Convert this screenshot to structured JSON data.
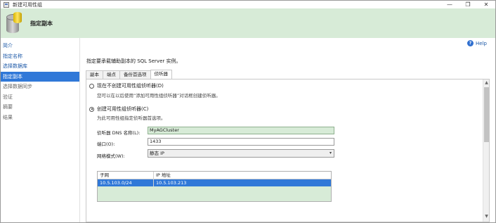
{
  "window": {
    "title": "新建可用性组",
    "controls": {
      "minimize": "—",
      "maximize": "❐",
      "close": "✕"
    }
  },
  "header": {
    "title": "指定副本"
  },
  "sidebar": {
    "items": [
      {
        "label": "简介",
        "state": "link"
      },
      {
        "label": "指定名称",
        "state": "link"
      },
      {
        "label": "选择数据库",
        "state": "link"
      },
      {
        "label": "指定副本",
        "state": "active"
      },
      {
        "label": "选择数据同步",
        "state": "muted"
      },
      {
        "label": "验证",
        "state": "muted"
      },
      {
        "label": "摘要",
        "state": "muted"
      },
      {
        "label": "结果",
        "state": "muted"
      }
    ]
  },
  "help": {
    "label": "Help",
    "icon": "help-icon"
  },
  "instruction": "指定要承载辅助副本的 SQL Server 实例。",
  "tabs": [
    {
      "label": "副本",
      "active": false
    },
    {
      "label": "端点",
      "active": false
    },
    {
      "label": "备份首选项",
      "active": false
    },
    {
      "label": "侦听器",
      "active": true
    }
  ],
  "listener": {
    "option_no_listener": {
      "label": "现在不创建可用性组侦听器(D)",
      "description": "您可以在以后使用“添加可用性组侦听器”对话框创建侦听器。",
      "checked": false
    },
    "option_create_listener": {
      "label": "创建可用性组侦听器(C)",
      "description": "为此可用性组指定侦听器首选项。",
      "checked": true
    },
    "dns_name": {
      "label": "侦听器 DNS 名称(L):",
      "value": "MyAGCluster"
    },
    "port": {
      "label": "端口(O):",
      "value": "1433"
    },
    "network_mode": {
      "label": "网络模式(W):",
      "value": "静态 IP"
    },
    "grid": {
      "columns": [
        "子网",
        "IP 地址"
      ],
      "rows": [
        {
          "subnet": "10.5.103.0/24",
          "ip": "10.5.103.213"
        }
      ]
    }
  },
  "colors": {
    "header_bg": "#d7ebd7",
    "active_nav": "#3078d8",
    "link": "#1e5aa8"
  }
}
